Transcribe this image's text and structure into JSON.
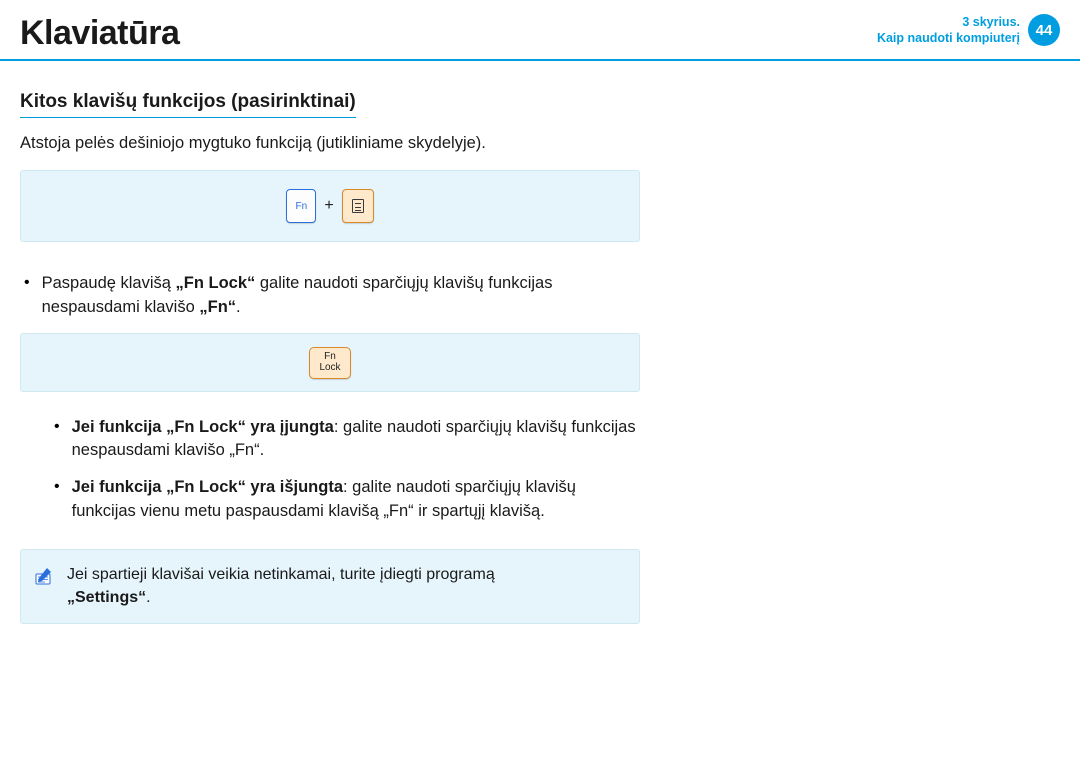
{
  "header": {
    "title": "Klaviatūra",
    "chapter_line1": "3 skyrius.",
    "chapter_line2": "Kaip naudoti kompiuterį",
    "page_number": "44"
  },
  "section": {
    "heading": "Kitos klavišų funkcijos (pasirinktinai)",
    "intro": "Atstoja pelės dešiniojo mygtuko funkciją (jutikliniame skydelyje)."
  },
  "keys": {
    "fn_label": "Fn",
    "plus": "+",
    "fnlock_line1": "Fn",
    "fnlock_line2": "Lock"
  },
  "bullet1": {
    "pre": "Paspaudę klavišą ",
    "bold": "„Fn Lock“",
    "mid": " galite naudoti sparčiųjų klavišų funkcijas nespausdami klavišo ",
    "bold2": "„Fn“",
    "post": "."
  },
  "sub1": {
    "bold": "Jei funkcija „Fn Lock“ yra įjungta",
    "rest": ": galite naudoti sparčiųjų klavišų funkcijas nespausdami klavišo „Fn“."
  },
  "sub2": {
    "bold": "Jei funkcija „Fn Lock“ yra išjungta",
    "rest": ": galite naudoti sparčiųjų klavišų funkcijas vienu metu paspausdami klavišą „Fn“ ir spartųjį klavišą."
  },
  "note": {
    "line1": "Jei spartieji klavišai veikia netinkamai, turite įdiegti programą ",
    "bold": "„Settings“",
    "post": "."
  }
}
